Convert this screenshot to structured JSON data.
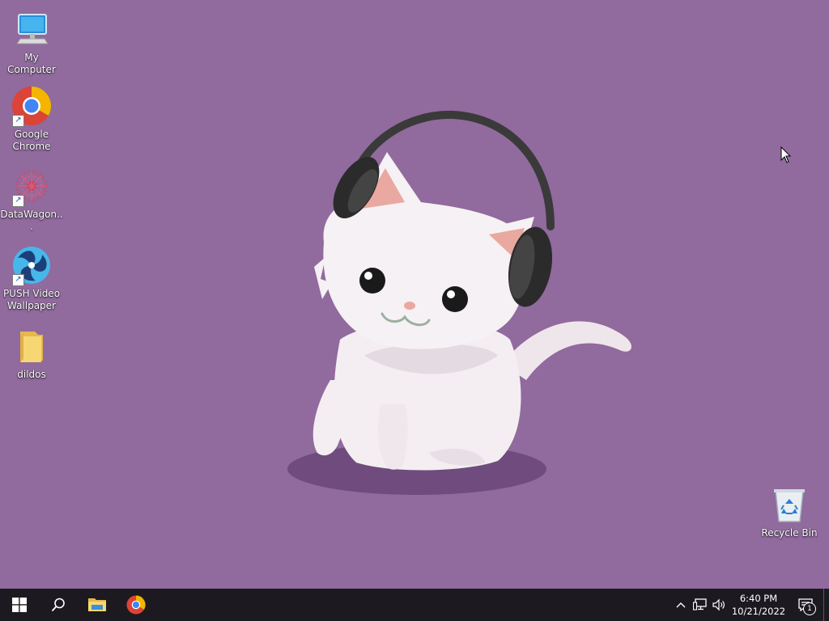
{
  "desktop": {
    "background_color": "#916a9e",
    "icons": [
      {
        "name": "my-computer",
        "label": "My Computer",
        "icon": "computer-icon",
        "shortcut": false
      },
      {
        "name": "google-chrome",
        "label": "Google\nChrome",
        "icon": "chrome-icon",
        "shortcut": true
      },
      {
        "name": "datawagon",
        "label": "DataWagon...",
        "icon": "datawagon-icon",
        "shortcut": true
      },
      {
        "name": "push-video-wallpaper",
        "label": "PUSH Video\nWallpaper",
        "icon": "push-video-wallpaper-icon",
        "shortcut": true
      },
      {
        "name": "dildos",
        "label": "dildos",
        "icon": "folder-icon",
        "shortcut": false
      },
      {
        "name": "recycle-bin",
        "label": "Recycle Bin",
        "icon": "recycle-bin-icon",
        "shortcut": false
      }
    ],
    "wallpaper": "white-cat-with-headphones"
  },
  "taskbar": {
    "background_color": "#1c1a20",
    "buttons": [
      {
        "name": "start-button",
        "icon": "windows-logo-icon"
      },
      {
        "name": "search-button",
        "icon": "search-icon"
      },
      {
        "name": "file-explorer-button",
        "icon": "file-explorer-icon"
      },
      {
        "name": "chrome-taskbar-button",
        "icon": "chrome-icon"
      }
    ],
    "tray": {
      "icons": [
        "chevron-up-icon",
        "network-icon",
        "volume-icon"
      ],
      "time": "6:40 PM",
      "date": "10/21/2022",
      "notification_count": "1"
    }
  }
}
